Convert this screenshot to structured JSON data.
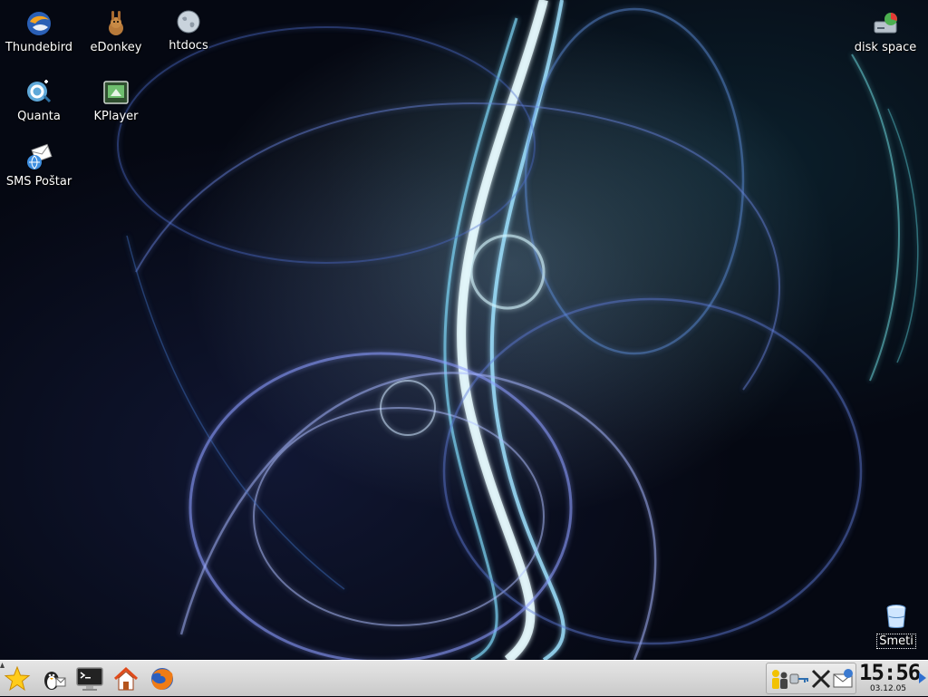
{
  "desktop": {
    "icons": [
      {
        "label": "Thundebird",
        "icon": "thunderbird-icon"
      },
      {
        "label": "eDonkey",
        "icon": "edonkey-icon"
      },
      {
        "label": "htdocs",
        "icon": "globe-folder-icon"
      },
      {
        "label": "Quanta",
        "icon": "quanta-icon"
      },
      {
        "label": "KPlayer",
        "icon": "kplayer-icon"
      },
      {
        "label": "SMS Poštar",
        "icon": "sms-postar-icon"
      },
      {
        "label": "disk space",
        "icon": "disk-space-icon"
      },
      {
        "label": "Smeti",
        "icon": "trash-icon"
      }
    ]
  },
  "taskbar": {
    "launchers": [
      {
        "name": "kmenu",
        "icon": "star-icon"
      },
      {
        "name": "kopete",
        "icon": "penguin-icon"
      },
      {
        "name": "konsole",
        "icon": "terminal-icon"
      },
      {
        "name": "home",
        "icon": "home-icon"
      },
      {
        "name": "firefox",
        "icon": "firefox-icon"
      }
    ],
    "tray": [
      {
        "name": "users",
        "icon": "users-icon"
      },
      {
        "name": "network",
        "icon": "network-key-icon"
      },
      {
        "name": "x-server",
        "icon": "x-icon"
      },
      {
        "name": "mail",
        "icon": "mail-icon"
      }
    ],
    "clock": {
      "time": "15:56",
      "date": "03.12.05"
    }
  },
  "colors": {
    "panel": "#d6d6d6",
    "wallpaper_base": "#050812",
    "wallpaper_glow": "#bfe8ff"
  }
}
